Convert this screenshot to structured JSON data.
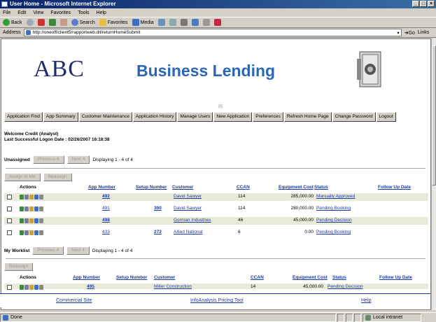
{
  "window": {
    "title": "User Home - Microsoft Internet Explorer"
  },
  "menu": [
    "File",
    "Edit",
    "View",
    "Favorites",
    "Tools",
    "Help"
  ],
  "toolbar": {
    "back": "Back",
    "search": "Search",
    "favorites": "Favorites",
    "media": "Media"
  },
  "address": {
    "label": "Address",
    "url": "http://oneoff/client5/rapportweb.dll/returnHomeSubmit",
    "go": "Go",
    "links": "Links"
  },
  "banner": {
    "logo_text": "ABC",
    "title": "Business Lending"
  },
  "nav": [
    "Application Find",
    "App Summary",
    "Customer Maintenance",
    "Application History",
    "Manage Users",
    "New Application",
    "Preferences",
    "Refresh Home Page",
    "Change Password",
    "Logout"
  ],
  "welcome": {
    "line1": "Welcome Credit (Analyst)",
    "line2": "Last Successful Logon Date : 02/26/2007 16:18:38"
  },
  "unassigned": {
    "label": "Unassigned",
    "prev": "Previous 4",
    "next": "Next 4",
    "displaying": "Displaying 1 - 4 of 4",
    "assign_to_me": "Assign to Me",
    "reassign": "Reassign",
    "headers": {
      "actions": "Actions",
      "app_number": "App Number",
      "setup_number": "Setup Number",
      "customer": "Customer",
      "ccan": "CCAN",
      "equipment_cost": "Equipment Cost",
      "status": "Status",
      "follow_up": "Follow Up Date"
    },
    "rows": [
      {
        "app": "492",
        "setup": "",
        "customer": "David Sawyer",
        "ccan": "114",
        "cost": "285,000.00",
        "status": "Manually Approved",
        "follow": ""
      },
      {
        "app": "491",
        "setup": "300",
        "customer": "David Sawyer",
        "ccan": "114",
        "cost": "280,000.00",
        "status": "Pending Booking",
        "follow": ""
      },
      {
        "app": "498",
        "setup": "",
        "customer": "Gorman Industries",
        "ccan": "46",
        "cost": "45,000.00",
        "status": "Pending Decision",
        "follow": ""
      },
      {
        "app": "433",
        "setup": "272",
        "customer": "Allied National",
        "ccan": "6",
        "cost": "0.00",
        "status": "Pending Booking",
        "follow": ""
      }
    ]
  },
  "worklist": {
    "label": "My Worklist",
    "prev": "Previous 4",
    "next": "Next 4",
    "displaying": "Displaying 1 - 4 of 4",
    "reassign": "Reassign",
    "headers": {
      "actions": "Actions",
      "app_number": "App Number",
      "setup_number": "Setup Number",
      "customer": "Customer",
      "ccan": "CCAN",
      "equipment_cost": "Equipment Cost",
      "status": "Status",
      "follow_up": "Follow Up Date"
    },
    "rows": [
      {
        "app": "495",
        "setup": "",
        "customer": "Miller Construction",
        "ccan": "14",
        "cost": "45,000.00",
        "status": "Pending Decision",
        "follow": ""
      }
    ]
  },
  "footer": {
    "commercial": "Commercial Site",
    "infoanalysis": "InfoAnalysis Pricing Tool",
    "help": "Help"
  },
  "status": {
    "text": "Done",
    "zone": "Local intranet"
  },
  "colors": {
    "title_bar": "#0a246a",
    "brand_blue": "#2a66b8",
    "logo_navy": "#1f2b70",
    "row_shade": "#e9ead9",
    "link": "#1a3aa0"
  }
}
